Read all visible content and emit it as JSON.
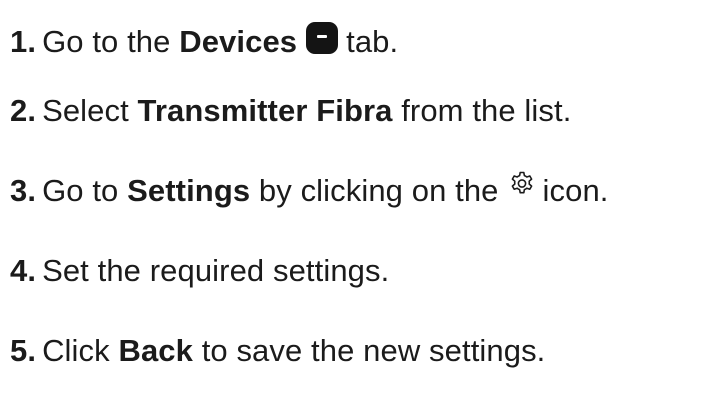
{
  "steps": [
    {
      "number": "1.",
      "parts": {
        "a": "Go to the",
        "bold": "Devices",
        "icon": "device-tab-icon",
        "b": "tab."
      }
    },
    {
      "number": "2.",
      "parts": {
        "a": "Select",
        "bold": "Transmitter Fibra",
        "b": "from the list."
      }
    },
    {
      "number": "3.",
      "parts": {
        "a": "Go to",
        "bold": "Settings",
        "b": "by clicking on the",
        "icon": "gear-icon",
        "c": "icon."
      }
    },
    {
      "number": "4.",
      "parts": {
        "a": "Set the required settings."
      }
    },
    {
      "number": "5.",
      "parts": {
        "a": "Click",
        "bold": "Back",
        "b": "to save the new settings."
      }
    }
  ]
}
